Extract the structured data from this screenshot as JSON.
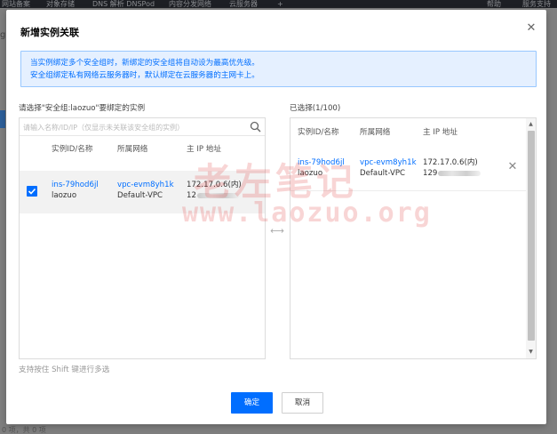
{
  "background": {
    "topbar_items": [
      "网站备案",
      "对象存储",
      "DNS 解析 DNSPod",
      "内容分发网络",
      "云服务器",
      "+",
      "帮助",
      "服务支持"
    ],
    "bottom_text": "0 项，共 0 项",
    "left_hint": "g"
  },
  "modal": {
    "title": "新增实例关联",
    "notice_line1": "当实例绑定多个安全组时，新绑定的安全组将自动设为最高优先级。",
    "notice_line2": "安全组绑定私有网络云服务器时，默认绑定在云服务器的主网卡上。",
    "left_label": "请选择\"安全组:laozuo\"要绑定的实例",
    "search_placeholder": "请输入名称/ID/IP（仅显示未关联该安全组的实例）",
    "right_label": "已选择(1/100)",
    "columns": [
      "实例ID/名称",
      "所属网络",
      "主 IP 地址"
    ],
    "instance": {
      "id": "ins-79hod6jl",
      "name": "laozuo",
      "vpc_id": "vpc-evm8yh1k",
      "vpc_name": "Default-VPC",
      "ip_private": "172.17.0.6(内)",
      "ip_public_prefix": "12",
      "ip_public_prefix_right": "129"
    },
    "hint": "支持按住 Shift 键进行多选",
    "ok_label": "确定",
    "cancel_label": "取消",
    "icons": {
      "close": "close-icon",
      "search": "search-icon",
      "check": "check-icon",
      "remove": "close-icon",
      "transfer": "transfer-icon"
    }
  },
  "watermark": {
    "line1": "老左笔记",
    "line2": "www.laozuo.org"
  },
  "colors": {
    "accent": "#006eff",
    "notice_bg": "#e5f0ff",
    "notice_border": "#97c7ff",
    "selected_row": "#f2f2f2",
    "watermark": "#e03e3e"
  }
}
